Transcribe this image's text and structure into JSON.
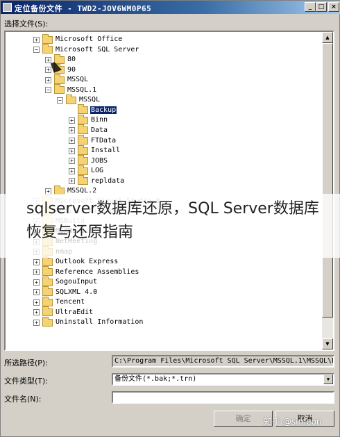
{
  "window": {
    "title": "定位备份文件 - TWD2-JOV6WM0P65",
    "minimize_glyph": "_",
    "maximize_glyph": "□",
    "close_glyph": "×"
  },
  "select_file_label": "选择文件(S):",
  "tree": [
    {
      "label": "Microsoft Office",
      "expander": "+",
      "depth": 0,
      "style": "normal"
    },
    {
      "label": "Microsoft SQL Server",
      "expander": "−",
      "depth": 0,
      "style": "normal"
    },
    {
      "label": "80",
      "expander": "+",
      "depth": 1,
      "style": "normal"
    },
    {
      "label": "90",
      "expander": "+",
      "depth": 1,
      "style": "normal"
    },
    {
      "label": "MSSQL",
      "expander": "+",
      "depth": 1,
      "style": "normal"
    },
    {
      "label": "MSSQL.1",
      "expander": "−",
      "depth": 1,
      "style": "normal"
    },
    {
      "label": "MSSQL",
      "expander": "−",
      "depth": 2,
      "style": "normal"
    },
    {
      "label": "Backup",
      "expander": "",
      "depth": 3,
      "style": "selected"
    },
    {
      "label": "Binn",
      "expander": "+",
      "depth": 3,
      "style": "normal"
    },
    {
      "label": "Data",
      "expander": "+",
      "depth": 3,
      "style": "normal"
    },
    {
      "label": "FTData",
      "expander": "+",
      "depth": 3,
      "style": "normal"
    },
    {
      "label": "Install",
      "expander": "+",
      "depth": 3,
      "style": "normal"
    },
    {
      "label": "JOBS",
      "expander": "+",
      "depth": 3,
      "style": "normal"
    },
    {
      "label": "LOG",
      "expander": "+",
      "depth": 3,
      "style": "normal"
    },
    {
      "label": "repldata",
      "expander": "+",
      "depth": 3,
      "style": "normal"
    },
    {
      "label": "MSSQL.2",
      "expander": "+",
      "depth": 1,
      "style": "normal"
    },
    {
      "label": "Microsoft Visual Studio 8",
      "expander": "+",
      "depth": 0,
      "style": "faded"
    },
    {
      "label": "Mozilla Firefox",
      "expander": "+",
      "depth": 0,
      "style": "faded"
    },
    {
      "label": "MSBuild",
      "expander": "+",
      "depth": 0,
      "style": "faded"
    },
    {
      "label": "MSXML 6.0",
      "expander": "+",
      "depth": 0,
      "style": "normal"
    },
    {
      "label": "NetMeeting",
      "expander": "+",
      "depth": 0,
      "style": "normal"
    },
    {
      "label": "nmap",
      "expander": "+",
      "depth": 0,
      "style": "normal"
    },
    {
      "label": "Outlook Express",
      "expander": "+",
      "depth": 0,
      "style": "normal"
    },
    {
      "label": "Reference Assemblies",
      "expander": "+",
      "depth": 0,
      "style": "normal"
    },
    {
      "label": "SogouInput",
      "expander": "+",
      "depth": 0,
      "style": "normal"
    },
    {
      "label": "SQLXML 4.0",
      "expander": "+",
      "depth": 0,
      "style": "normal"
    },
    {
      "label": "Tencent",
      "expander": "+",
      "depth": 0,
      "style": "normal"
    },
    {
      "label": "UltraEdit",
      "expander": "+",
      "depth": 0,
      "style": "normal"
    },
    {
      "label": "Uninstall Information",
      "expander": "+",
      "depth": 0,
      "style": "normal"
    }
  ],
  "scrollbar": {
    "up_glyph": "▲",
    "down_glyph": "▼"
  },
  "path_label": "所选路径(P):",
  "path_value": "C:\\Program Files\\Microsoft SQL Server\\MSSQL.1\\MSSQL\\Backup",
  "filetype_label": "文件类型(T):",
  "filetype_value": "备份文件(*.bak;*.trn)",
  "combo_glyph": "▼",
  "filename_label": "文件名(N):",
  "filename_value": "",
  "ok_button": "确定",
  "cancel_button": "取消",
  "overlay_text": "sqlserver数据库还原，SQL Server数据库恢复与还原指南",
  "watermark": "知乎 @simeon"
}
